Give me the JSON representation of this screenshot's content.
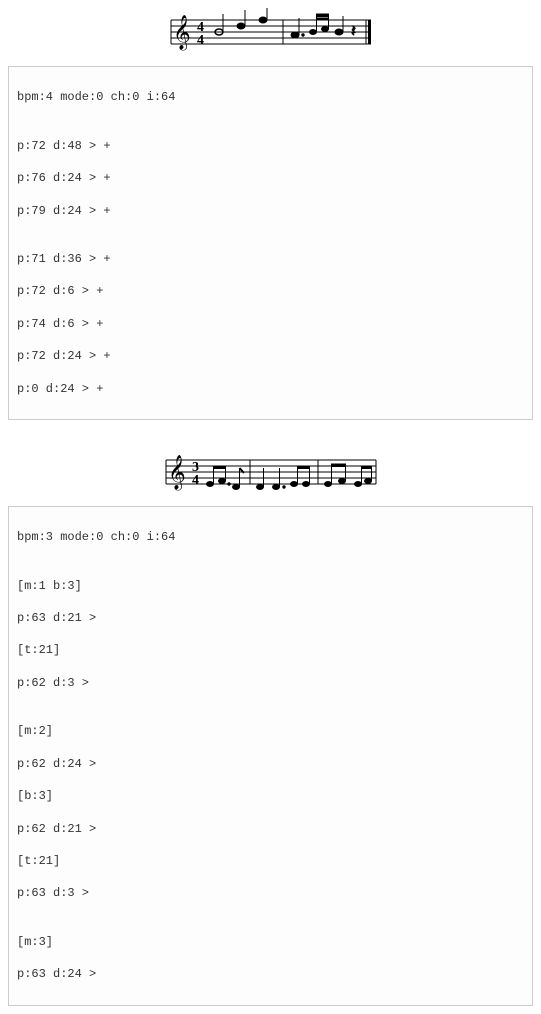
{
  "block1": {
    "header": "bpm:4 mode:0 ch:0 i:64",
    "groups": [
      [
        "p:72 d:48 > +",
        "p:76 d:24 > +",
        "p:79 d:24 > +"
      ],
      [
        "p:71 d:36 > +",
        "p:72 d:6 > +",
        "p:74 d:6 > +",
        "p:72 d:24 > +",
        "p:0 d:24 > +"
      ]
    ]
  },
  "block2": {
    "header": "bpm:3 mode:0 ch:0 i:64",
    "groups": [
      [
        "[m:1 b:3]",
        "p:63 d:21 >",
        "[t:21]",
        "p:62 d:3 >"
      ],
      [
        "[m:2]",
        "p:62 d:24 >",
        "[b:3]",
        "p:62 d:21 >",
        "[t:21]",
        "p:63 d:3 >"
      ],
      [
        "[m:3]",
        "p:63 d:24 >"
      ]
    ]
  }
}
